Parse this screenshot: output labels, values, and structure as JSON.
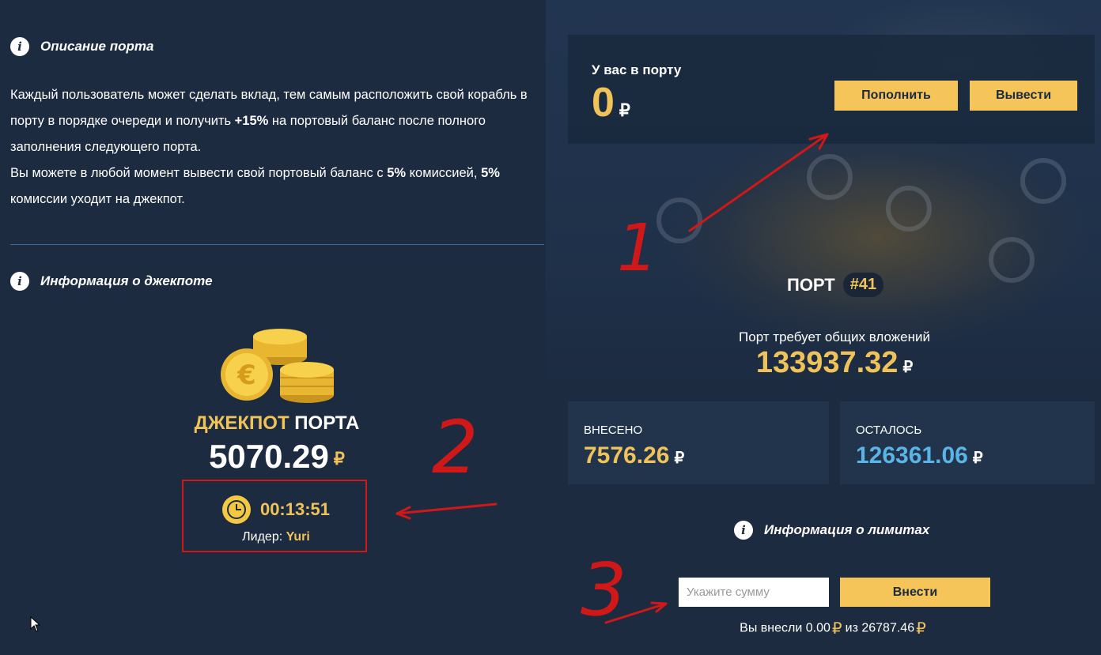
{
  "port_description": {
    "title": "Описание порта",
    "p1_a": "Каждый пользователь может сделать вклад, тем самым расположить свой корабль в порту в порядке очереди и получить ",
    "p1_bold": "+15%",
    "p1_b": " на портовый баланс после полного заполнения следующего порта.",
    "p2_a": "Вы можете в любой момент вывести свой портовый баланс с ",
    "p2_bold1": "5%",
    "p2_b": " комиссией, ",
    "p2_bold2": "5%",
    "p2_c": " комиссии уходит на джекпот."
  },
  "jackpot": {
    "heading": "Информация о джекпоте",
    "title_gold": "ДЖЕКПОТ",
    "title_white": "ПОРТА",
    "amount": "5070.29",
    "currency": "₽",
    "timer": "00:13:51",
    "leader_label": "Лидер:",
    "leader_name": "Yuri"
  },
  "balance": {
    "label": "У вас в порту",
    "value": "0",
    "currency": "₽",
    "deposit_button": "Пополнить",
    "withdraw_button": "Вывести"
  },
  "port": {
    "label": "ПОРТ",
    "number": "#41",
    "requires_label": "Порт требует общих вложений",
    "requires_value": "133937.32",
    "currency": "₽",
    "deposited_label": "ВНЕСЕНО",
    "deposited_value": "7576.26",
    "remaining_label": "ОСТАЛОСЬ",
    "remaining_value": "126361.06"
  },
  "limits": {
    "heading": "Информация о лимитах",
    "amount_placeholder": "Укажите сумму",
    "submit_button": "Внести",
    "note_a": "Вы внесли",
    "note_value": "0.00",
    "note_b": "из",
    "note_limit": "26787.46",
    "currency": "₽"
  },
  "annotations": {
    "mark1": "1",
    "mark2": "2",
    "mark3": "3"
  },
  "colors": {
    "background": "#1c2b40",
    "accent_gold": "#f0c35a",
    "button_gold": "#f5c55a",
    "remaining_blue": "#5ab4e6",
    "annotation_red": "#d01818"
  }
}
